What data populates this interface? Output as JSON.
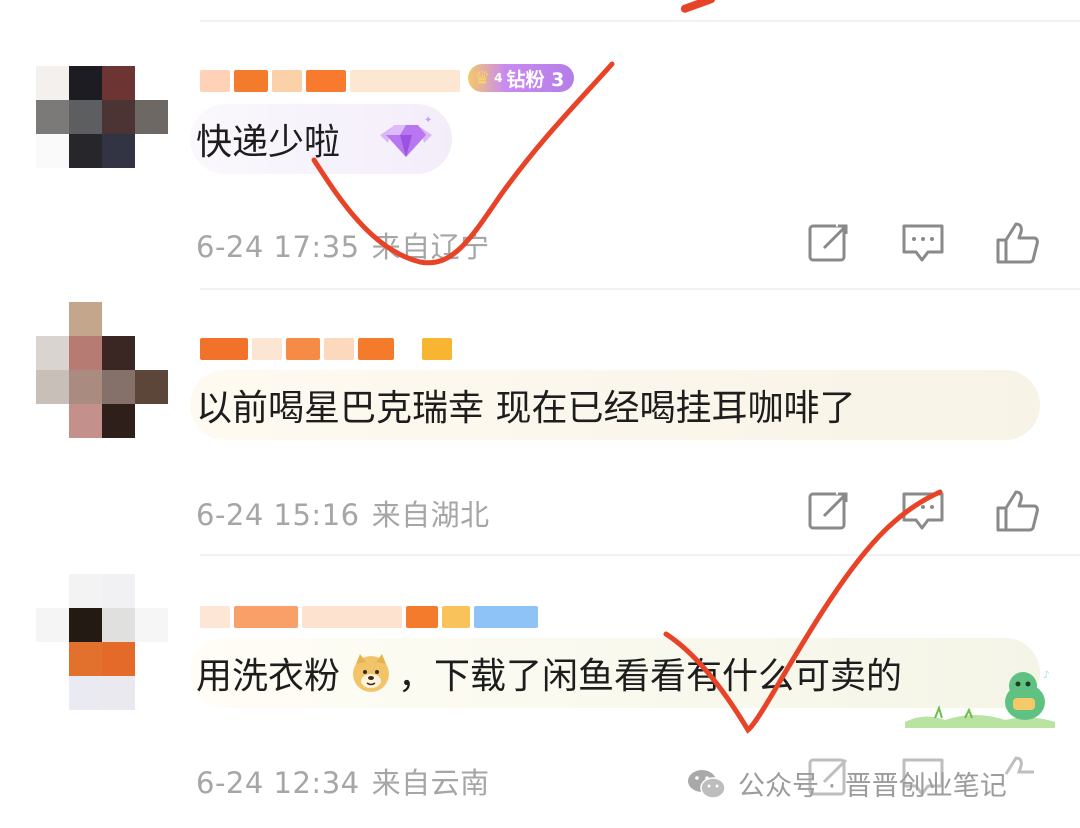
{
  "comments": [
    {
      "text": "快递少啦",
      "date": "6-24 17:35",
      "location": "来自辽宁",
      "badge": {
        "level": "4",
        "label": "钻粉 3"
      },
      "reaction_icon": "gem-icon"
    },
    {
      "text": "以前喝星巴克瑞幸 现在已经喝挂耳咖啡了",
      "date": "6-24 15:16",
      "location": "来自湖北"
    },
    {
      "text_before": "用洗衣粉",
      "text_after": "，下载了闲鱼看看有什么可卖的",
      "emoji_icon": "doge-icon",
      "date": "6-24 12:34",
      "location": "来自云南"
    }
  ],
  "action_icons": [
    "share-icon",
    "comment-icon",
    "like-icon"
  ],
  "watermark": {
    "text": "公众号 · 晋晋创业笔记",
    "icon": "wechat-icon"
  },
  "colors": {
    "checkmark": "#e94327",
    "meta_text": "#a6a6a6"
  }
}
